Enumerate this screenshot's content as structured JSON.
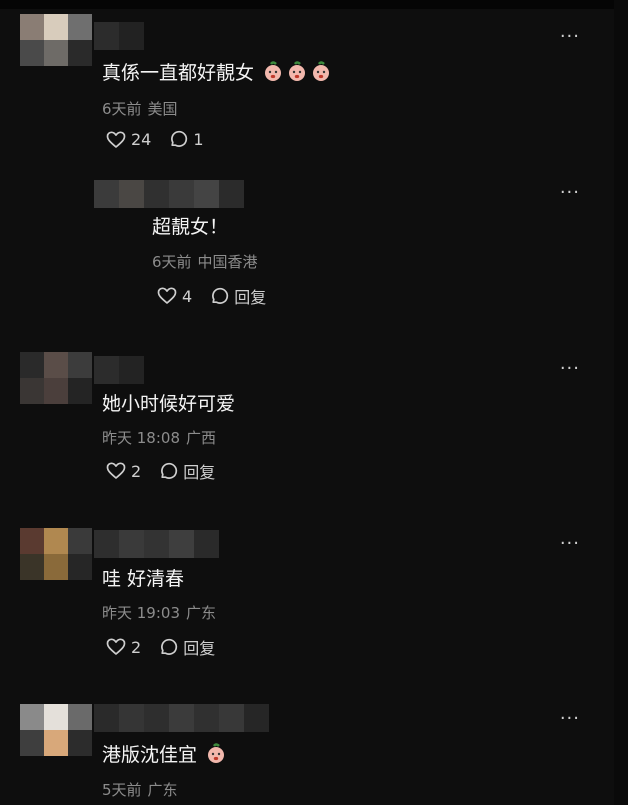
{
  "comments": [
    {
      "text": "真係一直都好靚女",
      "emojis": [
        "peach-face-emoji",
        "peach-face-emoji",
        "peach-face-emoji"
      ],
      "time": "6天前",
      "location": "美国",
      "likes": "24",
      "replies": "1",
      "reply_label": ""
    },
    {
      "text": "超靚女！",
      "time": "6天前",
      "location": "中国香港",
      "likes": "4",
      "reply_label": "回复"
    },
    {
      "text": "她小时候好可爱",
      "time": "昨天 18:08",
      "location": "广西",
      "likes": "2",
      "reply_label": "回复"
    },
    {
      "text": "哇 好清春",
      "time": "昨天 19:03",
      "location": "广东",
      "likes": "2",
      "reply_label": "回复"
    },
    {
      "text": "港版沈佳宜",
      "emojis": [
        "peach-face-emoji"
      ],
      "time": "5天前",
      "location": "广东"
    }
  ],
  "more_label": "···",
  "colors": {
    "background": "#0e0e0e",
    "text": "#f4f4f4",
    "meta": "#8c8c8c",
    "icon": "#cfcfcf"
  }
}
